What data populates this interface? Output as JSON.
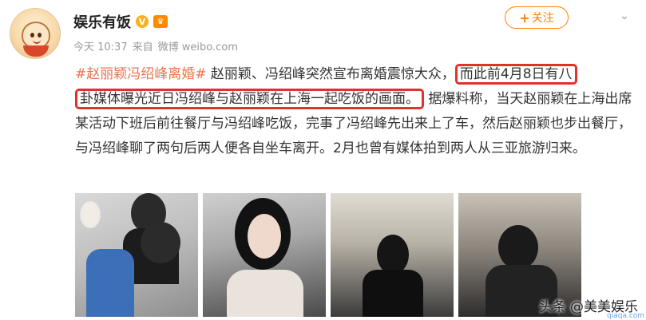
{
  "header": {
    "username": "娱乐有饭",
    "verified_mark": "V",
    "meta": {
      "time": "今天 10:37",
      "source_prefix": "来自",
      "source": "微博 weibo.com"
    },
    "follow_label": "关注",
    "follow_plus": "+",
    "more_label": "⌄"
  },
  "post": {
    "hashtag": "#赵丽颖冯绍峰离婚#",
    "text_1": " 赵丽颖、冯绍峰突然宣布离婚震惊大众，",
    "highlight_1": "而此前4月8日有八",
    "highlight_2": "卦媒体曝光近日冯绍峰与赵丽颖在上海一起吃饭的画面。",
    "text_2": "据爆料称，当天赵丽颖在上海出席某活动下班后前往餐厅与冯绍峰吃饭，完事了冯绍峰先出来上了车，然后赵丽颖也步出餐厅，与冯绍峰聊了两句后两人便各自坐车离开。2月也曾有媒体拍到两人从三亚旅游归来。"
  },
  "watermark": {
    "text": "头条 @美美娱乐",
    "logo": "",
    "url": "qiaqa.com"
  },
  "colors": {
    "brand_orange": "#ff8200",
    "hashtag": "#eb7350",
    "highlight_border": "#e0322a"
  }
}
